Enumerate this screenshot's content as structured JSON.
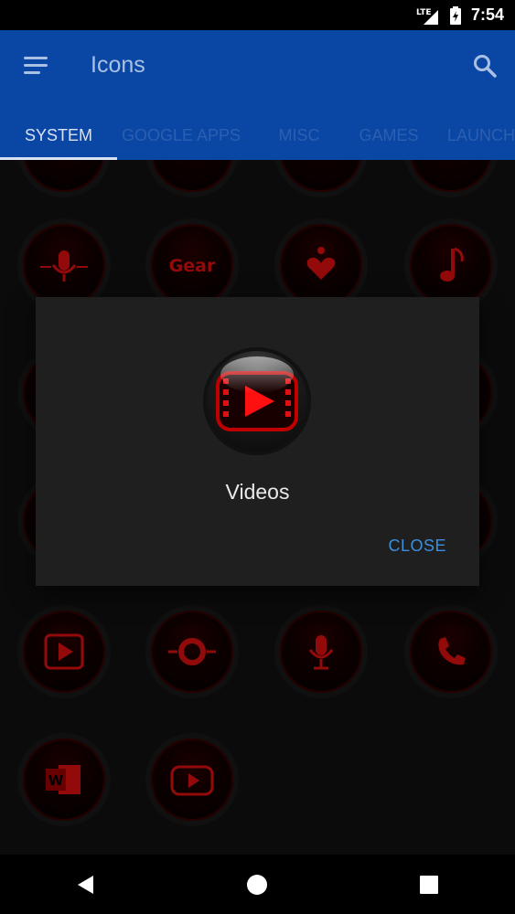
{
  "status_bar": {
    "network": "LTE",
    "time": "7:54"
  },
  "app_bar": {
    "title": "Icons",
    "tabs": [
      {
        "label": "SYSTEM",
        "active": true
      },
      {
        "label": "GOOGLE APPS",
        "active": false
      },
      {
        "label": "MISC",
        "active": false
      },
      {
        "label": "GAMES",
        "active": false
      },
      {
        "label": "LAUNCH",
        "active": false
      }
    ]
  },
  "grid": {
    "row_icons": [
      "microphone-icon",
      "gear-text-icon",
      "heart-download-icon",
      "music-note-icon"
    ],
    "row_icons_bottom": [
      "video-film-icon",
      "camera-icon",
      "microphone-icon",
      "phone-icon"
    ],
    "row_icons_last": [
      "word-document-icon",
      "youtube-play-icon"
    ],
    "gear_label": "Gear",
    "word_label": "W"
  },
  "dialog": {
    "title": "Videos",
    "close_label": "CLOSE",
    "icon": "video-play-icon"
  },
  "colors": {
    "accent": "#0a47a5",
    "icon_red": "#e01010",
    "link_blue": "#3a8fe0"
  }
}
